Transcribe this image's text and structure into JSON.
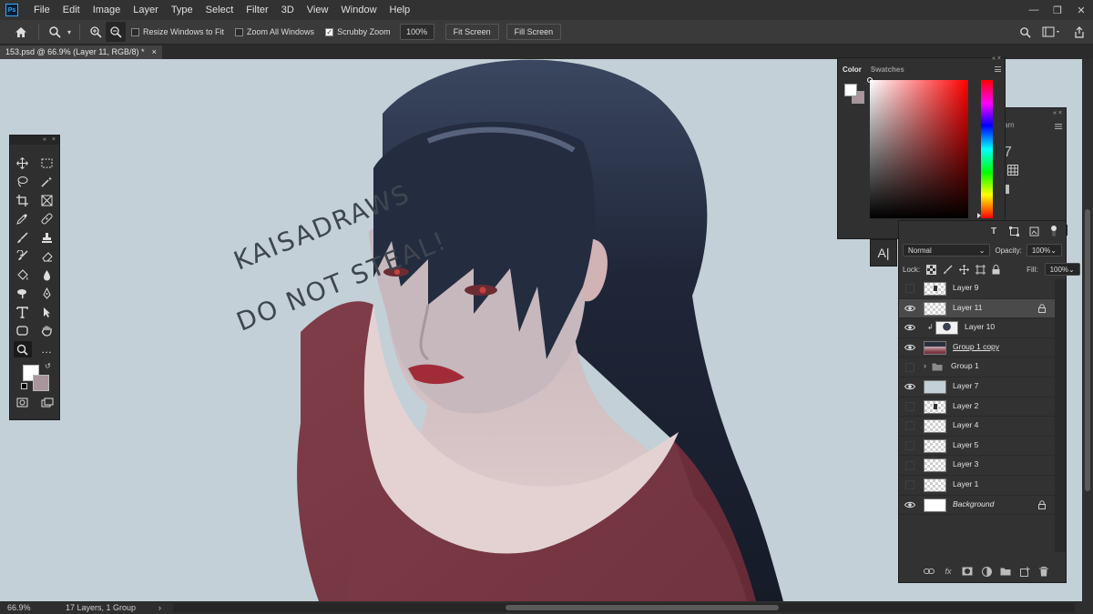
{
  "app": {
    "logo_text": "Ps",
    "menus": [
      "File",
      "Edit",
      "Image",
      "Layer",
      "Type",
      "Select",
      "Filter",
      "3D",
      "View",
      "Window",
      "Help"
    ]
  },
  "options_bar": {
    "resize_windows": "Resize Windows to Fit",
    "zoom_all": "Zoom All Windows",
    "scrubby_zoom": "Scrubby Zoom",
    "scrubby_checked": true,
    "zoom_value": "100%",
    "fit_screen": "Fit Screen",
    "fill_screen": "Fill Screen"
  },
  "document_tab": {
    "title": "153.psd @ 66.9% (Layer 11, RGB/8) *",
    "close": "×"
  },
  "canvas": {
    "watermark_line1": "KAISADRAWS",
    "watermark_line2": "DO NOT STEAL!"
  },
  "color_panel": {
    "tabs": [
      "Color",
      "Swatches"
    ],
    "foreground": "#ffffff",
    "background": "#a9959b"
  },
  "back_panel": {
    "title_fragment": "arn",
    "number_fragment": "7"
  },
  "layers_panel": {
    "blend_mode": "Normal",
    "opacity_label": "Opacity:",
    "opacity_value": "100%",
    "lock_label": "Lock:",
    "fill_label": "Fill:",
    "fill_value": "100%",
    "layers": [
      {
        "name": "Layer 9",
        "visible": false
      },
      {
        "name": "Layer 11",
        "visible": true,
        "selected": true,
        "locked": true
      },
      {
        "name": "Layer 10",
        "visible": true,
        "clipped": true
      },
      {
        "name": "Group 1 copy",
        "visible": true
      },
      {
        "name": "Group 1",
        "visible": false,
        "group": true
      },
      {
        "name": "Layer 7",
        "visible": true
      },
      {
        "name": "Layer 2",
        "visible": false
      },
      {
        "name": "Layer 4",
        "visible": false
      },
      {
        "name": "Layer 5",
        "visible": false
      },
      {
        "name": "Layer 3",
        "visible": false
      },
      {
        "name": "Layer 1",
        "visible": false
      },
      {
        "name": "Background",
        "visible": true,
        "locked": true,
        "italic": true
      }
    ]
  },
  "status_bar": {
    "zoom": "66.9%",
    "doc_info": "17 Layers, 1 Group",
    "arrow": "›"
  }
}
